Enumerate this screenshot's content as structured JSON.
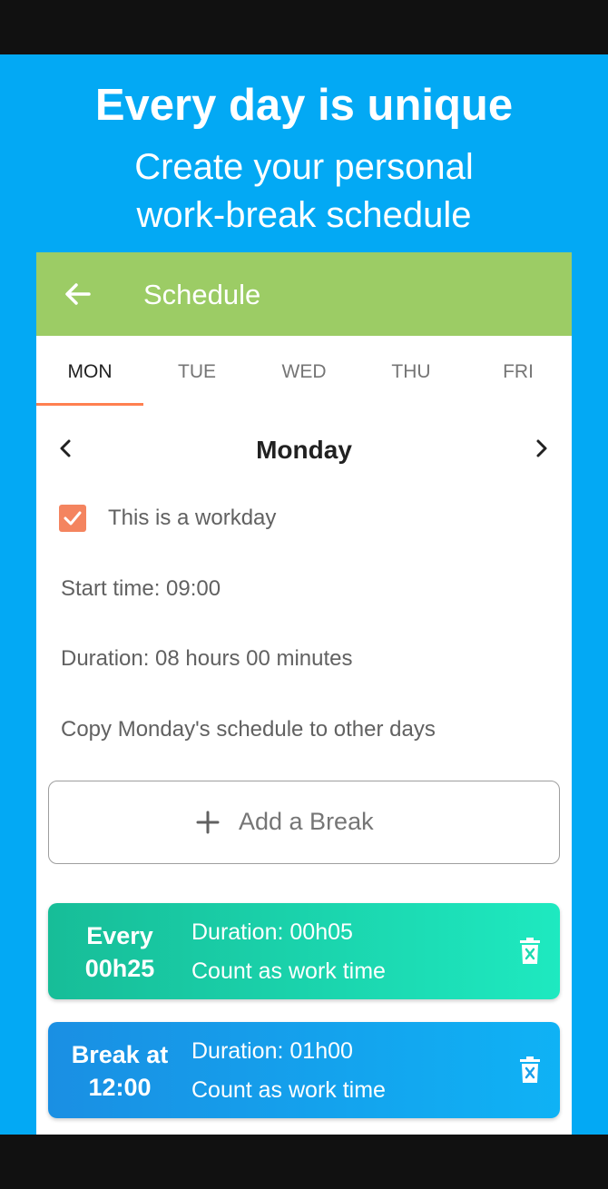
{
  "promo": {
    "headline": "Every day is unique",
    "subline_1": "Create your personal",
    "subline_2": "work-break schedule"
  },
  "appbar": {
    "back_icon": "arrow-left-icon",
    "title": "Schedule"
  },
  "tabs": [
    {
      "label": "MON",
      "active": true
    },
    {
      "label": "TUE",
      "active": false
    },
    {
      "label": "WED",
      "active": false
    },
    {
      "label": "THU",
      "active": false
    },
    {
      "label": "FRI",
      "active": false
    }
  ],
  "day": {
    "title": "Monday",
    "prev_icon": "chevron-left-icon",
    "next_icon": "chevron-right-icon"
  },
  "workday": {
    "checked": true,
    "label": "This is a workday"
  },
  "settings": {
    "start_time": "Start time: 09:00",
    "duration": "Duration: 08 hours 00 minutes",
    "copy": "Copy Monday's schedule to other days"
  },
  "add_break": {
    "icon": "plus-icon",
    "label": "Add a Break"
  },
  "breaks": [
    {
      "line1": "Every",
      "line2": "00h25",
      "duration": "Duration: 00h05",
      "count": "Count as work time",
      "delete_icon": "trash-icon"
    },
    {
      "line1": "Break at",
      "line2": "12:00",
      "duration": "Duration: 01h00",
      "count": "Count as work time",
      "delete_icon": "trash-icon"
    }
  ],
  "colors": {
    "background": "#03a9f4",
    "appbar": "#9ccc65",
    "accent": "#ff7f50",
    "checkbox": "#f4845f",
    "card_green": "#1ed9b0",
    "card_blue": "#1a9ee9"
  }
}
